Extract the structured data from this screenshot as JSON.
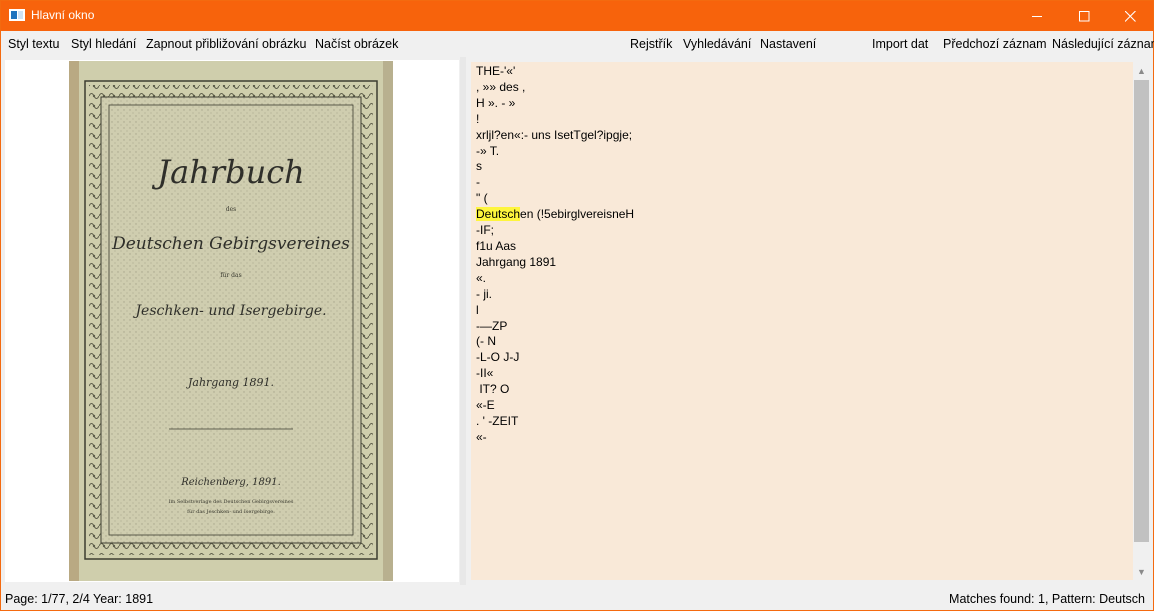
{
  "window": {
    "title": "Hlavní okno"
  },
  "menu": {
    "left": [
      "Styl textu",
      "Styl hledání",
      "Zapnout přibližování obrázku",
      "Načíst obrázek"
    ],
    "right": [
      "Rejstřík",
      "Vyhledávání",
      "Nastavení",
      "Import dat",
      "Předchozí záznam",
      "Následující záznam"
    ]
  },
  "cover": {
    "title": "Jahrbuch",
    "des": "des",
    "line2": "Deutschen Gebirgsvereines",
    "fur": "für das",
    "line3": "Jeschken- und Isergebirge.",
    "year_line": "Jahrgang 1891.",
    "city": "Reichenberg, 1891.",
    "publisher1": "Im Selbstverlage des Deutschen Gebirgsvereines",
    "publisher2": "für das Jeschken- und Isergebirge."
  },
  "ocr": {
    "lines": [
      "THE-'«'",
      ", »» des ,",
      "H ». - »",
      "!",
      "xrljl?en«:- uns IsetTgel?ipgje;",
      "-» T.",
      "s",
      "-",
      "\" (",
      "",
      "-IF;",
      "f1u Aas",
      "Jahrgang 1891",
      "«.",
      "- ji.",
      "l",
      "-—ZP",
      "(- N",
      "-L-O J-J",
      "-II«",
      " IT? O",
      "«-E",
      ". ' -ZEIT",
      "«-"
    ],
    "match_highlight": "Deutsch",
    "match_rest": "en (!5ebirglvereisneH"
  },
  "status": {
    "left": "Page: 1/77, 2/4  Year: 1891",
    "right": "Matches found: 1, Pattern: Deutsch"
  }
}
